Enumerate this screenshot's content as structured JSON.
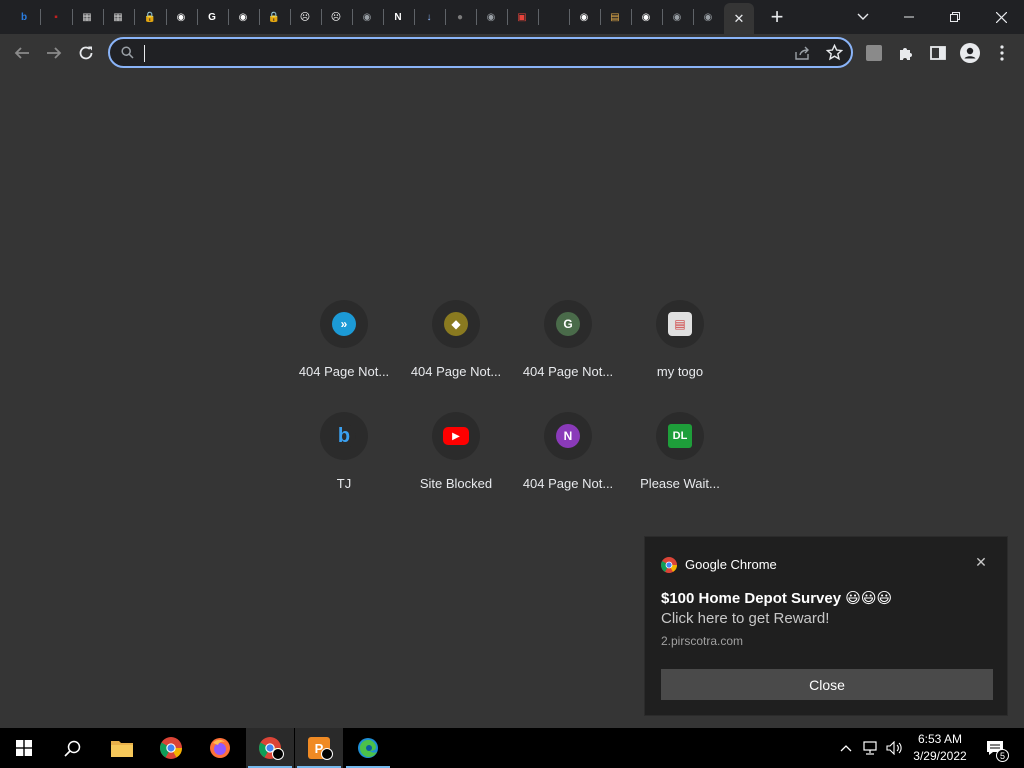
{
  "tabs": [
    {
      "icon": "bing-icon",
      "color": "#2a7de1",
      "glyph": "b"
    },
    {
      "icon": "red-logo-icon",
      "color": "#c02020",
      "glyph": "▪"
    },
    {
      "icon": "box-icon",
      "color": "#d0d0d0",
      "glyph": "▦"
    },
    {
      "icon": "box-icon",
      "color": "#d0d0d0",
      "glyph": "▦"
    },
    {
      "icon": "lock-icon",
      "color": "#c0c0c0",
      "glyph": "🔒"
    },
    {
      "icon": "globe-icon",
      "color": "#ffffff",
      "glyph": "◉"
    },
    {
      "icon": "google-icon",
      "color": "#ffffff",
      "glyph": "G"
    },
    {
      "icon": "globe-icon",
      "color": "#ffffff",
      "glyph": "◉"
    },
    {
      "icon": "lock-icon",
      "color": "#c0c0c0",
      "glyph": "🔒"
    },
    {
      "icon": "sad-page-icon",
      "color": "#ffffff",
      "glyph": "☹"
    },
    {
      "icon": "sad-page-icon",
      "color": "#ffffff",
      "glyph": "☹"
    },
    {
      "icon": "globe-icon",
      "color": "#9aa0a6",
      "glyph": "◉"
    },
    {
      "icon": "new-badge-icon",
      "color": "#ffffff",
      "glyph": "N"
    },
    {
      "icon": "download-icon",
      "color": "#8ab4f8",
      "glyph": "↓"
    },
    {
      "icon": "gray-circle-icon",
      "color": "#7a7a7a",
      "glyph": "●"
    },
    {
      "icon": "globe-icon",
      "color": "#9aa0a6",
      "glyph": "◉"
    },
    {
      "icon": "red-shop-icon",
      "color": "#e8433a",
      "glyph": "▣"
    },
    {
      "icon": "blank-icon",
      "color": "#202124",
      "glyph": ""
    },
    {
      "icon": "globe-icon",
      "color": "#ffffff",
      "glyph": "◉"
    },
    {
      "icon": "store-icon",
      "color": "#e8b04a",
      "glyph": "▤"
    },
    {
      "icon": "globe-icon",
      "color": "#ffffff",
      "glyph": "◉"
    },
    {
      "icon": "globe-icon",
      "color": "#9aa0a6",
      "glyph": "◉"
    },
    {
      "icon": "globe-icon",
      "color": "#9aa0a6",
      "glyph": "◉"
    }
  ],
  "active_tab_close": "✕",
  "new_tab_label": "+",
  "omnibox": {
    "value": "",
    "placeholder": ""
  },
  "tiles": [
    {
      "label": "404 Page Not...",
      "icon": "arrow-logo-icon",
      "bg": "#1c9ad6",
      "glyph": "»"
    },
    {
      "label": "404 Page Not...",
      "icon": "box-logo-icon",
      "bg": "#8a7a20",
      "glyph": "◆"
    },
    {
      "label": "404 Page Not...",
      "icon": "letter-g-icon",
      "bg": "#4a6b4a",
      "glyph": "G"
    },
    {
      "label": "my togo",
      "icon": "store-icon",
      "bg": "#e0e0e0",
      "glyph": "▤"
    },
    {
      "label": "TJ",
      "icon": "bing-icon",
      "bg": "#2b2b2b",
      "glyph": "b"
    },
    {
      "label": "Site Blocked",
      "icon": "youtube-icon",
      "bg": "#ff0000",
      "glyph": "▶"
    },
    {
      "label": "404 Page Not...",
      "icon": "letter-n-icon",
      "bg": "#8a3ab9",
      "glyph": "N"
    },
    {
      "label": "Please Wait...",
      "icon": "dl-logo-icon",
      "bg": "#1e9e3a",
      "glyph": "DL"
    }
  ],
  "notification": {
    "app": "Google Chrome",
    "title": "$100 Home Depot Survey 😃😃😃",
    "body": "Click here to get Reward!",
    "source": "2.pirscotra.com",
    "close_label": "Close"
  },
  "clock": {
    "time": "6:53 AM",
    "date": "3/29/2022"
  },
  "notification_count": "5"
}
